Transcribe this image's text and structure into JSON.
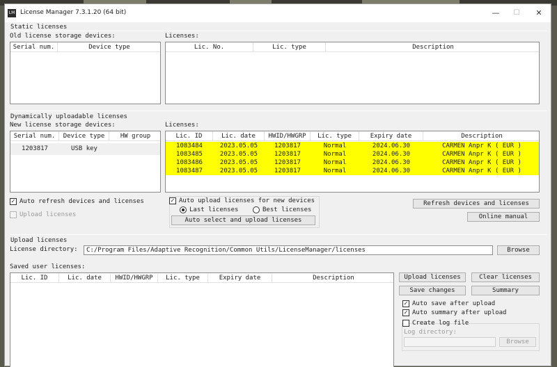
{
  "window": {
    "title": "License Manager 7.3.1.20 (64 bit)",
    "icon_label": "LM",
    "minimize_glyph": "—",
    "maximize_glyph": "☐",
    "close_glyph": "✕"
  },
  "static_licenses": {
    "section_title": "Static licenses",
    "devices_label": "Old license storage devices:",
    "devices_columns": [
      "Serial num.",
      "Device type"
    ],
    "licenses_label": "Licenses:",
    "licenses_columns": [
      "Lic. No.",
      "Lic. type",
      "Description"
    ]
  },
  "dynamic_licenses": {
    "section_title": "Dynamically uploadable licenses",
    "devices_label": "New license storage devices:",
    "devices_columns": [
      "Serial num.",
      "Device type",
      "HW group"
    ],
    "devices_rows": [
      {
        "serial": "1203817",
        "device_type": "USB key",
        "hw_group": ""
      }
    ],
    "licenses_label": "Licenses:",
    "licenses_columns": [
      "Lic. ID",
      "Lic. date",
      "HWID/HWGRP",
      "Lic. type",
      "Expiry date",
      "Description"
    ],
    "licenses_rows": [
      {
        "id": "1083484",
        "date": "2023.05.05",
        "hwid": "1203817",
        "type": "Normal",
        "expiry": "2024.06.30",
        "description": "CARMEN Anpr K ( EUR )"
      },
      {
        "id": "1083485",
        "date": "2023.05.05",
        "hwid": "1203817",
        "type": "Normal",
        "expiry": "2024.06.30",
        "description": "CARMEN Anpr K ( EUR )"
      },
      {
        "id": "1083486",
        "date": "2023.05.05",
        "hwid": "1203817",
        "type": "Normal",
        "expiry": "2024.06.30",
        "description": "CARMEN Anpr K ( EUR )"
      },
      {
        "id": "1083487",
        "date": "2023.05.05",
        "hwid": "1203817",
        "type": "Normal",
        "expiry": "2024.06.30",
        "description": "CARMEN Anpr K ( EUR )"
      }
    ],
    "highlight_color": "#ffff00",
    "auto_refresh_label": "Auto refresh devices and licenses",
    "auto_refresh_checked": true,
    "upload_licenses_label": "Upload licenses",
    "upload_licenses_checked": false,
    "auto_upload_label": "Auto upload licenses for new devices",
    "auto_upload_checked": true,
    "last_licenses_label": "Last licenses",
    "best_licenses_label": "Best licenses",
    "selected_mode": "last",
    "auto_select_button": "Auto select and upload licenses",
    "refresh_button": "Refresh devices and licenses",
    "online_manual_button": "Online manual",
    "check_glyph": "✓"
  },
  "upload_licenses": {
    "section_title": "Upload licenses",
    "directory_label": "License directory:",
    "directory_value": "C:/Program Files/Adaptive Recognition/Common Utils/LicenseManager/licenses",
    "browse_button": "Browse",
    "saved_label": "Saved user licenses:",
    "saved_columns": [
      "Lic. ID",
      "Lic. date",
      "HWID/HWGRP",
      "Lic. type",
      "Expiry date",
      "Description"
    ],
    "upload_button": "Upload licenses",
    "clear_button": "Clear licenses",
    "save_changes_button": "Save changes",
    "summary_button": "Summary",
    "auto_save_label": "Auto save after upload",
    "auto_save_checked": true,
    "auto_summary_label": "Auto summary after upload",
    "auto_summary_checked": true,
    "create_log_label": "Create log file",
    "create_log_checked": false,
    "log_directory_label": "Log directory:",
    "log_directory_value": "",
    "log_browse_button": "Browse"
  }
}
